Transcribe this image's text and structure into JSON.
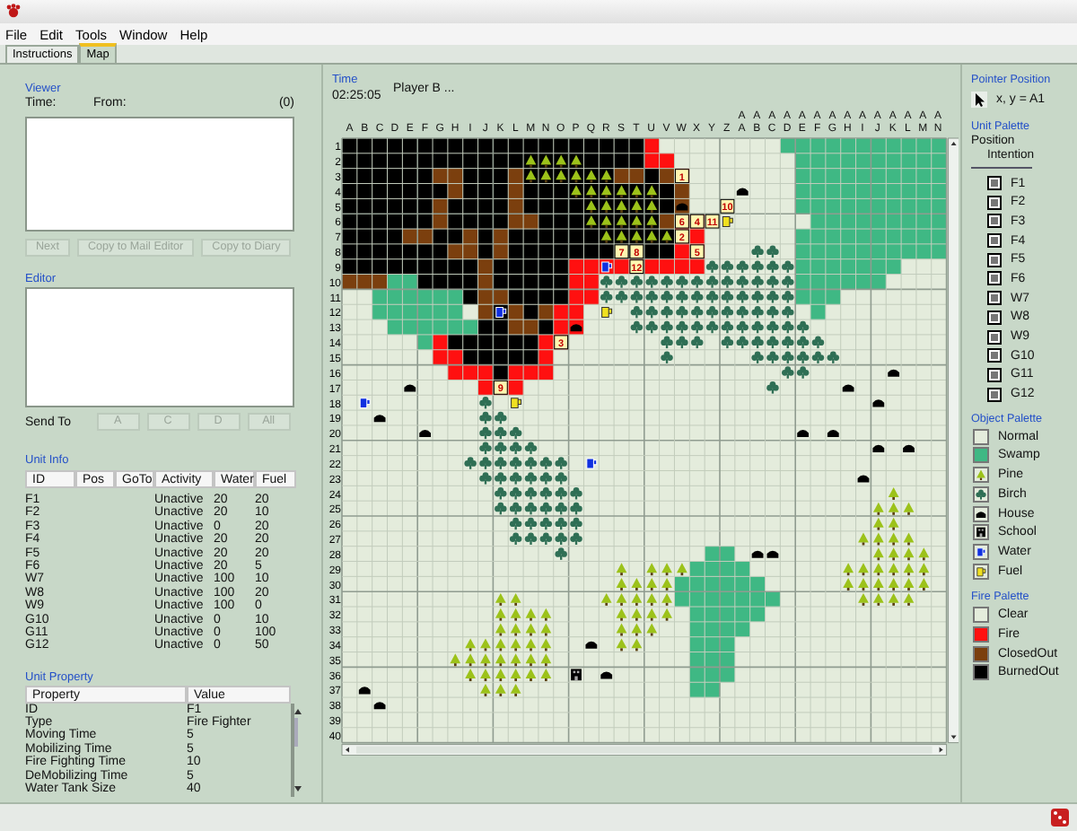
{
  "menu": [
    "File",
    "Edit",
    "Tools",
    "Window",
    "Help"
  ],
  "tabs": [
    {
      "label": "Instructions",
      "selected": false
    },
    {
      "label": "Map",
      "selected": true
    }
  ],
  "viewer": {
    "label": "Viewer",
    "time_label": "Time:",
    "from_label": "From:",
    "count": "(0)",
    "buttons": [
      {
        "label": "Next",
        "disabled": true
      },
      {
        "label": "Copy to Mail Editor",
        "disabled": true
      },
      {
        "label": "Copy to Diary",
        "disabled": true
      }
    ]
  },
  "editor": {
    "label": "Editor",
    "send_to_label": "Send To",
    "send_buttons": [
      {
        "label": "A",
        "disabled": true
      },
      {
        "label": "C",
        "disabled": true
      },
      {
        "label": "D",
        "disabled": true
      },
      {
        "label": "All",
        "disabled": true
      }
    ]
  },
  "unit_info": {
    "label": "Unit Info",
    "columns": [
      "ID",
      "Pos",
      "GoTo",
      "Activity",
      "Water",
      "Fuel"
    ],
    "rows": [
      {
        "id": "F1",
        "activity": "Unactive",
        "water": "20",
        "fuel": "20"
      },
      {
        "id": "F2",
        "activity": "Unactive",
        "water": "20",
        "fuel": "10"
      },
      {
        "id": "F3",
        "activity": "Unactive",
        "water": "0",
        "fuel": "20"
      },
      {
        "id": "F4",
        "activity": "Unactive",
        "water": "20",
        "fuel": "20"
      },
      {
        "id": "F5",
        "activity": "Unactive",
        "water": "20",
        "fuel": "20"
      },
      {
        "id": "F6",
        "activity": "Unactive",
        "water": "20",
        "fuel": "5"
      },
      {
        "id": "W7",
        "activity": "Unactive",
        "water": "100",
        "fuel": "10"
      },
      {
        "id": "W8",
        "activity": "Unactive",
        "water": "100",
        "fuel": "20"
      },
      {
        "id": "W9",
        "activity": "Unactive",
        "water": "100",
        "fuel": "0"
      },
      {
        "id": "G10",
        "activity": "Unactive",
        "water": "0",
        "fuel": "10"
      },
      {
        "id": "G11",
        "activity": "Unactive",
        "water": "0",
        "fuel": "100"
      },
      {
        "id": "G12",
        "activity": "Unactive",
        "water": "0",
        "fuel": "50"
      }
    ]
  },
  "unit_property": {
    "label": "Unit Property",
    "columns": [
      "Property",
      "Value"
    ],
    "rows": [
      {
        "property": "ID",
        "value": "F1"
      },
      {
        "property": "Type",
        "value": "Fire Fighter"
      },
      {
        "property": "Moving Time",
        "value": "5"
      },
      {
        "property": "Mobilizing Time",
        "value": "5"
      },
      {
        "property": "Fire Fighting Time",
        "value": "10"
      },
      {
        "property": "DeMobilizing Time",
        "value": "5"
      },
      {
        "property": "Water Tank Size",
        "value": "40"
      }
    ]
  },
  "time": {
    "label": "Time",
    "value": "02:25:05"
  },
  "player": "Player B ...",
  "map": {
    "columns": [
      "A",
      "B",
      "C",
      "D",
      "E",
      "F",
      "G",
      "H",
      "I",
      "J",
      "K",
      "L",
      "M",
      "N",
      "O",
      "P",
      "Q",
      "R",
      "S",
      "T",
      "U",
      "V",
      "W",
      "X",
      "Y",
      "Z",
      "AA",
      "AB",
      "AC",
      "AD",
      "AE",
      "AF",
      "AG",
      "AH",
      "AI",
      "AJ",
      "AK",
      "AL",
      "AM",
      "AN"
    ],
    "rows": [
      "1",
      "2",
      "3",
      "4",
      "5",
      "6",
      "7",
      "8",
      "9",
      "10",
      "11",
      "12",
      "13",
      "14",
      "15",
      "16",
      "17",
      "18",
      "19",
      "20",
      "21",
      "22",
      "23",
      "24",
      "25",
      "26",
      "27",
      "28",
      "29",
      "30",
      "31",
      "32",
      "33",
      "34",
      "35",
      "36",
      "37",
      "38",
      "39",
      "40"
    ],
    "unit_markers": [
      {
        "label": "1"
      },
      {
        "label": "10"
      },
      {
        "label": "6"
      },
      {
        "label": "4"
      },
      {
        "label": "11"
      },
      {
        "label": "2"
      },
      {
        "label": "7"
      },
      {
        "label": "8"
      },
      {
        "label": "5"
      },
      {
        "label": "12"
      },
      {
        "label": "3"
      },
      {
        "label": "9"
      }
    ]
  },
  "pointer_position": {
    "label": "Pointer Position",
    "value": "x, y =  A1"
  },
  "unit_palette": {
    "label": "Unit Palette",
    "headers": [
      "Position",
      "Intention"
    ],
    "units": [
      "F1",
      "F2",
      "F3",
      "F4",
      "F5",
      "F6",
      "W7",
      "W8",
      "W9",
      "G10",
      "G11",
      "G12"
    ]
  },
  "object_palette": {
    "label": "Object Palette",
    "items": [
      {
        "label": "Normal",
        "kind": "normal"
      },
      {
        "label": "Swamp",
        "kind": "swamp"
      },
      {
        "label": "Pine",
        "kind": "pine"
      },
      {
        "label": "Birch",
        "kind": "birch"
      },
      {
        "label": "House",
        "kind": "house"
      },
      {
        "label": "School",
        "kind": "school"
      },
      {
        "label": "Water",
        "kind": "water"
      },
      {
        "label": "Fuel",
        "kind": "fuel"
      }
    ]
  },
  "fire_palette": {
    "label": "Fire Palette",
    "items": [
      {
        "label": "Clear",
        "color": "#e4ecdc"
      },
      {
        "label": "Fire",
        "color": "#ff1010"
      },
      {
        "label": "ClosedOut",
        "color": "#7b3f0e"
      },
      {
        "label": "BurnedOut",
        "color": "#000000"
      }
    ]
  }
}
